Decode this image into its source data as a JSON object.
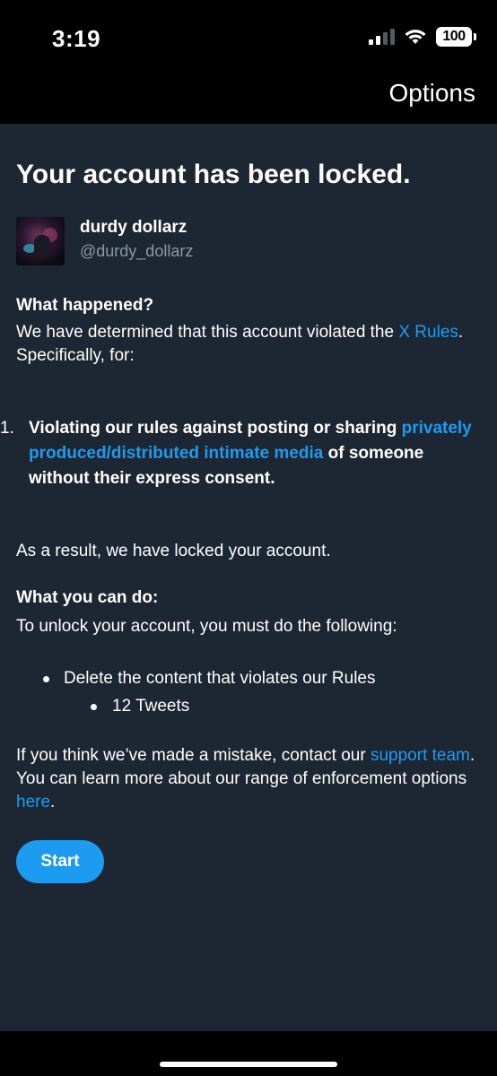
{
  "status_bar": {
    "time": "3:19",
    "battery": "100"
  },
  "header": {
    "options_label": "Options"
  },
  "page": {
    "title": "Your account has been locked."
  },
  "account": {
    "display_name": "durdy dollarz",
    "handle": "@durdy_dollarz"
  },
  "what_happened": {
    "heading": "What happened?",
    "text_before_link": "We have determined that this account violated the ",
    "link_text": "X Rules",
    "text_after_link": ". Specifically, for:"
  },
  "violations": [
    {
      "number": "1.",
      "text_before_link": "Violating our rules against posting or sharing ",
      "link_text": "privately produced/distributed intimate media",
      "text_after_link": " of someone without their express consent."
    }
  ],
  "result_text": "As a result, we have locked your account.",
  "what_you_can_do": {
    "heading": "What you can do:",
    "text": "To unlock your account, you must do the following:",
    "steps": [
      {
        "label": "Delete the content that violates our Rules",
        "sub_items": [
          "12 Tweets"
        ]
      }
    ]
  },
  "footer_text": {
    "text_1": "If you think we’ve made a mistake, contact our ",
    "support_link": "support team",
    "text_2": ". You can learn more about our range of enforcement options ",
    "here_link": "here",
    "text_3": "."
  },
  "start_button": {
    "label": "Start"
  },
  "colors": {
    "background": "#1c2733",
    "link": "#1d9bf0",
    "button": "#1d9bf0",
    "secondary_text": "#8b98a5"
  }
}
